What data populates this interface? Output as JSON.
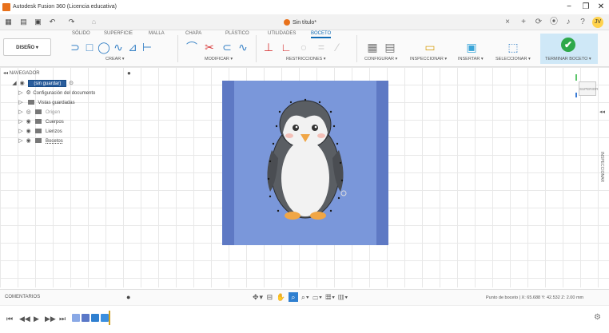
{
  "window": {
    "title": "Autodesk Fusion 360 (Licencia educativa)",
    "minimize": "−",
    "maximize": "❐",
    "close": "✕"
  },
  "doc_tab": {
    "title": "Sin título*",
    "close": "×",
    "new_tab": "+"
  },
  "quick_access": {
    "grid": "▦",
    "file": "▤",
    "save": "▣",
    "undo": "↶",
    "redo": "↷",
    "home": "⌂"
  },
  "right_icons": {
    "sync": "⟳",
    "jobs": "⦿",
    "notify": "♪",
    "help": "?",
    "user": "JV"
  },
  "ribbon": {
    "workspace": "DISEÑO ▾",
    "tabs": [
      "SÓLIDO",
      "SUPERFICIE",
      "MALLA",
      "CHAPA",
      "PLÁSTICO",
      "UTILIDADES",
      "BOCETO"
    ],
    "active_tab": "BOCETO",
    "groups": [
      "CREAR ▾",
      "MODIFICAR ▾",
      "RESTRICCIONES ▾",
      "CONFIGURAR ▾",
      "INSPECCIONAR ▾",
      "INSERTAR ▾",
      "SELECCIONAR ▾",
      "TERMINAR BOCETO ▾"
    ]
  },
  "browser": {
    "header": "NAVEGADOR",
    "root": "(sin guardar)",
    "items": [
      "Configuración del documento",
      "Vistas guardadas",
      "Origen",
      "Cuerpos",
      "Lienzos",
      "Bocetos"
    ]
  },
  "viewcube": {
    "face": "SUPERIOR"
  },
  "side_panel": {
    "label": "INSPECCIONAR"
  },
  "status": {
    "comments": "COMENTARIOS",
    "coords": "Punto de boceto | X: 65.688 Y: 42.532 Z: 2.00 mm"
  },
  "colors": {
    "accent": "#0f6bb5",
    "sketch_fill": "#7a97da",
    "finish_check": "#2ea84a",
    "app_orange": "#e8711b"
  }
}
